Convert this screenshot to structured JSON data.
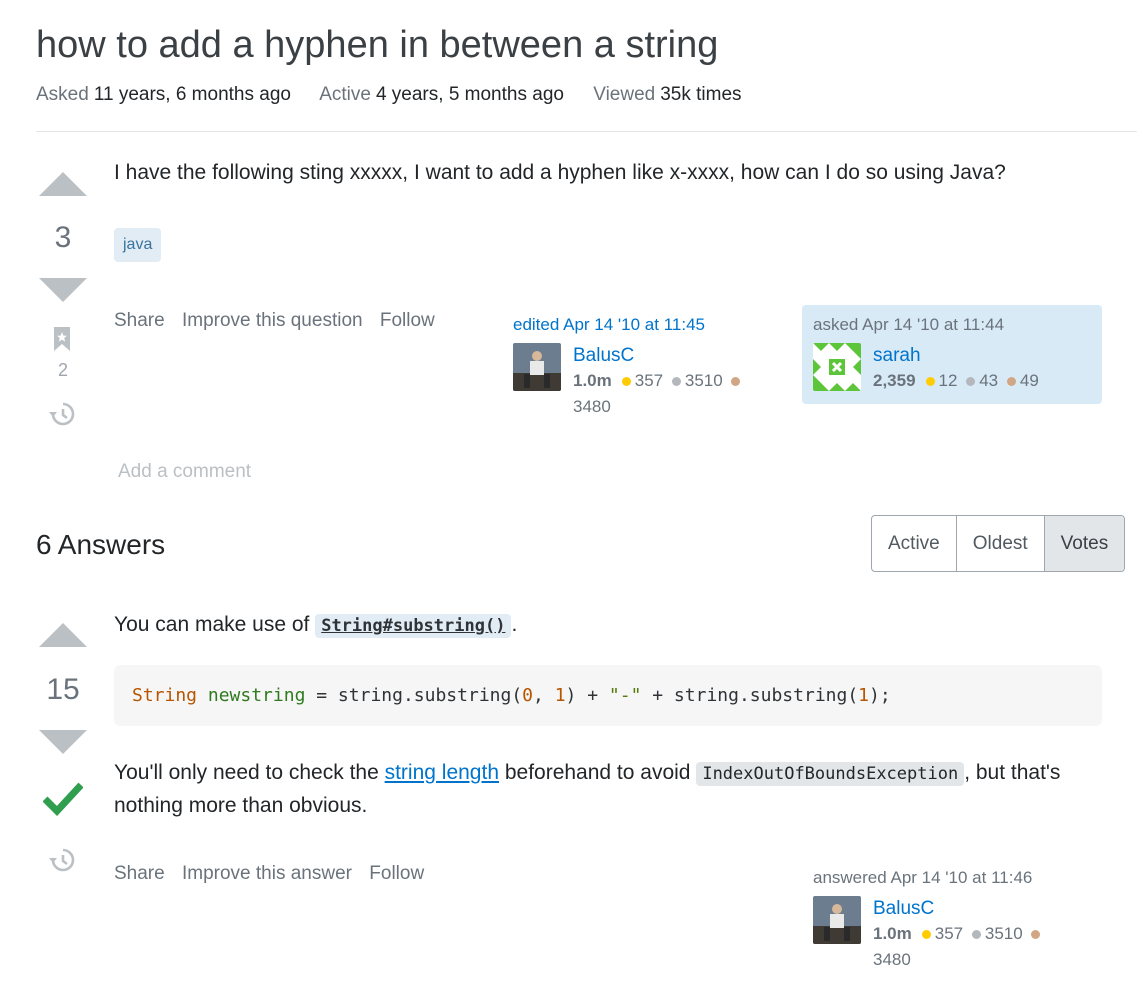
{
  "question": {
    "title": "how to add a hyphen in between a string",
    "meta": {
      "asked_label": "Asked",
      "asked_value": "11 years, 6 months ago",
      "active_label": "Active",
      "active_value": "4 years, 5 months ago",
      "viewed_label": "Viewed",
      "viewed_value": "35k times"
    },
    "votes": "3",
    "bookmark_count": "2",
    "body": "I have the following sting xxxxx, I want to add a hyphen like x-xxxx, how can I do so using Java?",
    "tags": [
      "java"
    ],
    "menu": {
      "share": "Share",
      "improve": "Improve this question",
      "follow": "Follow"
    },
    "edited": {
      "action": "edited Apr 14 '10 at 11:45",
      "user": "BalusC",
      "rep": "1.0m",
      "gold": "357",
      "silver": "3510",
      "bronze": "3480"
    },
    "asked": {
      "action": "asked Apr 14 '10 at 11:44",
      "user": "sarah",
      "rep": "2,359",
      "gold": "12",
      "silver": "43",
      "bronze": "49"
    },
    "add_comment": "Add a comment"
  },
  "answers_header": "6 Answers",
  "sort_tabs": [
    "Active",
    "Oldest",
    "Votes"
  ],
  "answer": {
    "votes": "15",
    "intro_before": "You can make use of ",
    "intro_code": "String#substring()",
    "intro_after": ".",
    "code": {
      "t1": "String",
      "t2": " ",
      "t3": "newstring",
      "t4": " = string.substring(",
      "t5": "0",
      "t6": ", ",
      "t7": "1",
      "t8": ") + ",
      "t9": "\"-\"",
      "t10": " + string.substring(",
      "t11": "1",
      "t12": ");"
    },
    "para_before": "You'll only need to check the ",
    "para_link": "string length",
    "para_mid": " beforehand to avoid ",
    "para_code": "IndexOutOfBoundsException",
    "para_after": ", but that's nothing more than obvious.",
    "menu": {
      "share": "Share",
      "improve": "Improve this answer",
      "follow": "Follow"
    },
    "answered": {
      "action": "answered Apr 14 '10 at 11:46",
      "user": "BalusC",
      "rep": "1.0m",
      "gold": "357",
      "silver": "3510",
      "bronze": "3480"
    }
  },
  "colors": {
    "accent": "#0074cc",
    "accepted": "#2f9e4f",
    "tag_bg": "#e1ecf4"
  },
  "icons": [
    "bookmark-icon",
    "history-icon",
    "accepted-check-icon",
    "upvote-icon",
    "downvote-icon"
  ]
}
